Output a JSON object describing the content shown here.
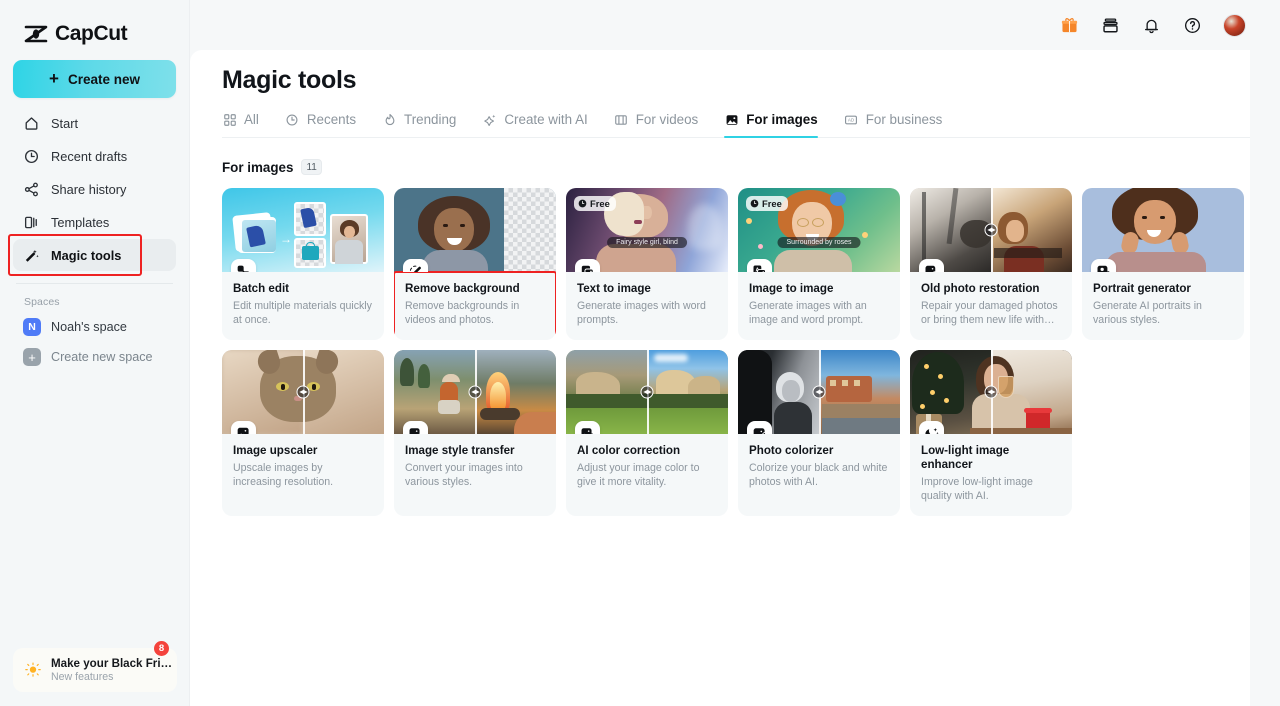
{
  "brand": {
    "name": "CapCut",
    "logo_icon": "capcut-logo-icon"
  },
  "sidebar": {
    "create_new_label": "Create new",
    "items": [
      {
        "label": "Start",
        "icon": "home-icon",
        "active": false
      },
      {
        "label": "Recent drafts",
        "icon": "clock-icon",
        "active": false
      },
      {
        "label": "Share history",
        "icon": "share-icon",
        "active": false
      },
      {
        "label": "Templates",
        "icon": "templates-icon",
        "active": false
      },
      {
        "label": "Magic tools",
        "icon": "magic-wand-icon",
        "active": true
      }
    ],
    "spaces_title": "Spaces",
    "spaces": [
      {
        "label": "Noah's space",
        "badge": "N",
        "badge_color": "#4f7bf7"
      },
      {
        "label": "Create new space",
        "badge": "+",
        "badge_color": "#99a3ab"
      }
    ],
    "promo": {
      "title": "Make your Black Fri…",
      "subtitle": "New features",
      "badge": "8",
      "icon": "lightbulb-icon"
    }
  },
  "topbar": {
    "icons": [
      {
        "name": "gift-icon",
        "color": "#f5862a"
      },
      {
        "name": "wallet-icon",
        "color": "#15181c"
      },
      {
        "name": "bell-icon",
        "color": "#15181c"
      },
      {
        "name": "help-icon",
        "color": "#15181c"
      }
    ],
    "avatar": "user-avatar"
  },
  "header": {
    "title": "Magic tools"
  },
  "tabs": [
    {
      "label": "All",
      "icon": "grid-icon",
      "active": false
    },
    {
      "label": "Recents",
      "icon": "clock-icon",
      "active": false
    },
    {
      "label": "Trending",
      "icon": "flame-icon",
      "active": false
    },
    {
      "label": "Create with AI",
      "icon": "sparkle-icon",
      "active": false
    },
    {
      "label": "For videos",
      "icon": "film-icon",
      "active": false
    },
    {
      "label": "For images",
      "icon": "image-icon",
      "active": true
    },
    {
      "label": "For business",
      "icon": "business-icon",
      "active": false
    }
  ],
  "group": {
    "title": "For images",
    "count": "11"
  },
  "accent_color": "#2fd2e4",
  "highlight_color": "#ee2222",
  "cards": [
    {
      "title": "Batch edit",
      "desc": "Edit multiple materials quickly at once.",
      "tool_icon": "batch-edit-icon",
      "thumb": "batch-edit-thumb",
      "free": false,
      "highlighted": false,
      "compare": false
    },
    {
      "title": "Remove background",
      "desc": "Remove backgrounds in videos and photos.",
      "tool_icon": "remove-background-icon",
      "thumb": "remove-background-thumb",
      "free": false,
      "highlighted": true,
      "compare": false
    },
    {
      "title": "Text to image",
      "desc": "Generate images with word prompts.",
      "tool_icon": "text-to-image-icon",
      "thumb": "text-to-image-thumb",
      "prompt": "Fairy style girl, blind",
      "free": true,
      "free_label": "Free",
      "highlighted": false,
      "compare": false
    },
    {
      "title": "Image to image",
      "desc": "Generate images with an image and word prompt.",
      "tool_icon": "image-to-image-icon",
      "thumb": "image-to-image-thumb",
      "prompt": "Surrounded by roses",
      "free": true,
      "free_label": "Free",
      "highlighted": false,
      "compare": false
    },
    {
      "title": "Old photo restoration",
      "desc": "Repair your damaged photos or bring them new life with…",
      "tool_icon": "old-photo-restoration-icon",
      "thumb": "old-photo-restoration-thumb",
      "free": false,
      "highlighted": false,
      "compare": true
    },
    {
      "title": "Portrait generator",
      "desc": "Generate AI portraits in various styles.",
      "tool_icon": "portrait-generator-icon",
      "thumb": "portrait-generator-thumb",
      "free": false,
      "highlighted": false,
      "compare": false
    },
    {
      "title": "Image upscaler",
      "desc": "Upscale images by increasing resolution.",
      "tool_icon": "image-upscaler-icon",
      "thumb": "image-upscaler-thumb",
      "free": false,
      "highlighted": false,
      "compare": true
    },
    {
      "title": "Image style transfer",
      "desc": "Convert your images into various styles.",
      "tool_icon": "image-style-transfer-icon",
      "thumb": "image-style-transfer-thumb",
      "free": false,
      "highlighted": false,
      "compare": true
    },
    {
      "title": "AI color correction",
      "desc": "Adjust your image color to give it more vitality.",
      "tool_icon": "ai-color-correction-icon",
      "thumb": "ai-color-correction-thumb",
      "free": false,
      "highlighted": false,
      "compare": true
    },
    {
      "title": "Photo colorizer",
      "desc": "Colorize your black and white photos with AI.",
      "tool_icon": "photo-colorizer-icon",
      "thumb": "photo-colorizer-thumb",
      "free": false,
      "highlighted": false,
      "compare": true
    },
    {
      "title": "Low-light image enhancer",
      "desc": "Improve low-light image quality with AI.",
      "tool_icon": "low-light-enhancer-icon",
      "thumb": "low-light-enhancer-thumb",
      "free": false,
      "highlighted": false,
      "compare": true
    }
  ]
}
